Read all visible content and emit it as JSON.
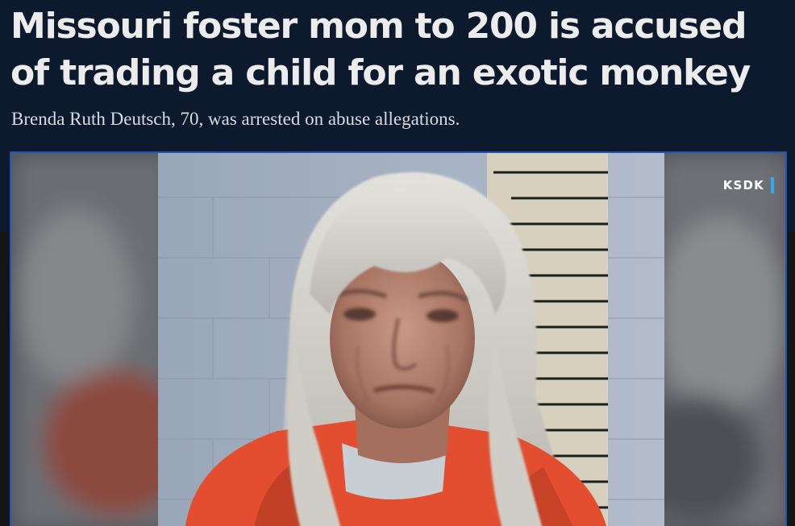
{
  "article": {
    "headline": "Missouri foster mom to 200 is accused of trading a child for an exotic monkey",
    "subheadline": "Brenda Ruth Deutsch, 70, was arrested on abuse allegations.",
    "image_credit": "KSDK"
  },
  "colors": {
    "page_background": "#0d1a2e",
    "headline_text": "#ececec",
    "image_border": "#1f56b8",
    "credit_accent": "#36a9f0"
  },
  "icons": {
    "photo": "mugshot-photo"
  }
}
